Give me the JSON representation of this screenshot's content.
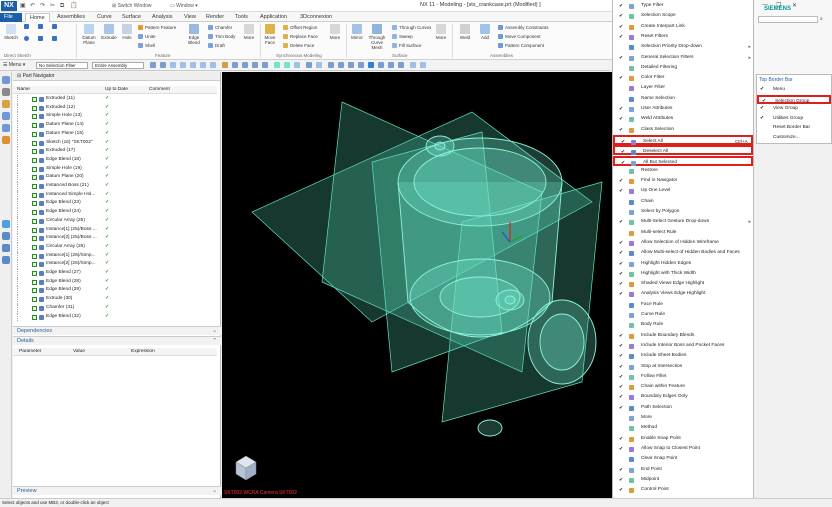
{
  "app": {
    "logo": "NX",
    "title": "NX 11 - Modeling - [sts_crankcase.prt (Modified) ]",
    "switch_window": "Switch Window",
    "window": "Window",
    "brand": "SIEMENS"
  },
  "tabs": [
    "File",
    "Home",
    "Assemblies",
    "Curve",
    "Surface",
    "Analysis",
    "View",
    "Render",
    "Tools",
    "Application",
    "3Dconnexion"
  ],
  "ribbon": {
    "sketch": "Sketch",
    "direct_sketch": "Direct Sketch",
    "datum": "Datum Plane",
    "extrude": "Extrude",
    "hole": "Hole",
    "pattern_feature": "Pattern Feature",
    "unite": "Unite",
    "shell": "Shell",
    "edge_blend": "Edge Blend",
    "chamfer": "Chamfer",
    "trim_body": "Trim Body",
    "draft": "Draft",
    "more1": "More",
    "feature": "Feature",
    "move_face": "Move Face",
    "offset_region": "Offset Region",
    "replace_face": "Replace Face",
    "delete_face": "Delete Face",
    "synchronous": "Synchronous Modeling",
    "more2": "More",
    "mirror": "Mirror",
    "through_curve_mesh": "Through Curve Mesh",
    "through_curves": "Through Curves",
    "sweep": "Sweep",
    "fill_surface": "Fill Surface",
    "surface": "Surface",
    "more3": "More",
    "weld": "Weld",
    "add": "Add",
    "assembly_constraints": "Assembly Constraints",
    "move_component": "Move Component",
    "pattern_component": "Pattern Component",
    "assemblies": "Assemblies"
  },
  "toolbar": {
    "menu": "Menu",
    "filter": "No Selection Filter",
    "scope": "Entire Assembly"
  },
  "navigator": {
    "title": "Part Navigator",
    "columns": [
      "Name",
      "Up to Date",
      "Comment"
    ],
    "rows": [
      "Extruded (11)",
      "Extruded (12)",
      "Simple Hole (13)",
      "Datum Plane (14)",
      "Datum Plane (15)",
      "Sketch (16) \"SKT002\"",
      "Extruded (17)",
      "Edge Blend (18)",
      "Simple Hole (19)",
      "Datum Plane (20)",
      "Instanced Boss (21)",
      "Instanced Simple Hol...",
      "Edge Blend (23)",
      "Edge Blend (24)",
      "Circular Array (25)",
      "Instance[1] (25)/Boss ...",
      "Instance[2] (25)/Boss ...",
      "Circular Array (26)",
      "Instance[1] (26)/Simp...",
      "Instance[2] (26)/Simp...",
      "Edge Blend (27)",
      "Edge Blend (28)",
      "Edge Blend (29)",
      "Extrude (30)",
      "Chamfer (31)",
      "Edge Blend (32)"
    ],
    "dependencies": "Dependencies",
    "details": "Details",
    "detail_cols": [
      "Parameter",
      "Value",
      "Expression"
    ],
    "preview": "Preview"
  },
  "viewport": {
    "caption": "SKT002 WCRA Camera SKT002"
  },
  "menu": {
    "items": [
      {
        "label": "Type Filter",
        "check": true
      },
      {
        "label": "Selection Scope",
        "check": true
      },
      {
        "label": "Create Interpart Link",
        "check": true
      },
      {
        "label": "Reset Filters",
        "check": true
      },
      {
        "label": "Selection Priority Drop-down",
        "check": false,
        "arrow": true
      },
      {
        "label": "General Selection Filters",
        "check": true,
        "arrow": true
      },
      {
        "label": "Detailed Filtering",
        "check": false
      },
      {
        "label": "Color Filter",
        "check": true
      },
      {
        "label": "Layer Filter",
        "check": false
      },
      {
        "label": "Name Selection",
        "check": false
      },
      {
        "label": "User Attributes",
        "check": true
      },
      {
        "label": "Weld Attributes",
        "check": true
      },
      {
        "label": "Class Selection",
        "check": true
      },
      {
        "label": "Select All",
        "check": true,
        "shortcut": "Ctrl+A",
        "hl": true
      },
      {
        "label": "Deselect All",
        "check": true,
        "hl": true
      },
      {
        "label": "All But Selected",
        "check": true,
        "hl": true
      },
      {
        "label": "Restore",
        "check": false
      },
      {
        "label": "Find in Navigator",
        "check": true
      },
      {
        "label": "Up One Level",
        "check": true
      },
      {
        "label": "Chain",
        "check": false
      },
      {
        "label": "Select by Polygon",
        "check": false
      },
      {
        "label": "Multi-Select Gesture Drop-down",
        "check": true,
        "arrow": true
      },
      {
        "label": "Multi-select Rule",
        "check": false
      },
      {
        "label": "Allow Selection of Hidden Wireframe",
        "check": true
      },
      {
        "label": "Allow Multi-select of Hidden Bodies and Faces",
        "check": true
      },
      {
        "label": "Highlight Hidden Edges",
        "check": true
      },
      {
        "label": "Highlight with Thick Width",
        "check": true
      },
      {
        "label": "Shaded Views Edge Highlight",
        "check": true
      },
      {
        "label": "Analysis Views Edge Highlight",
        "check": true
      },
      {
        "label": "Face Rule",
        "check": false
      },
      {
        "label": "Curve Rule",
        "check": false
      },
      {
        "label": "Body Rule",
        "check": false
      },
      {
        "label": "Include Boundary Blends",
        "check": true
      },
      {
        "label": "Include Interior Boss and Pocket Faces",
        "check": true
      },
      {
        "label": "Include Sheet Bodies",
        "check": true
      },
      {
        "label": "Stop at Intersection",
        "check": true
      },
      {
        "label": "Follow Fillet",
        "check": true
      },
      {
        "label": "Chain within Feature",
        "check": true
      },
      {
        "label": "Boundary Edges Only",
        "check": true
      },
      {
        "label": "Path Selection",
        "check": true
      },
      {
        "label": "More",
        "check": false
      },
      {
        "label": "Method",
        "check": false
      },
      {
        "label": "Enable Snap Point",
        "check": true
      },
      {
        "label": "Allow Snap to Closest Point",
        "check": true
      },
      {
        "label": "Clear Snap Point",
        "check": false
      },
      {
        "label": "End Point",
        "check": true
      },
      {
        "label": "Midpoint",
        "check": true
      },
      {
        "label": "Control Point",
        "check": true
      }
    ]
  },
  "submenu": {
    "title": "Top Border Bar",
    "items": [
      {
        "label": "Menu",
        "check": true
      },
      {
        "label": "Selection Group",
        "check": true,
        "hl": true
      },
      {
        "label": "View Group",
        "check": true
      },
      {
        "label": "Utilities Group",
        "check": true
      },
      {
        "label": "Reset Border Bar",
        "check": false
      },
      {
        "label": "Customize...",
        "check": false
      }
    ]
  },
  "status": "Select objects and use MB3, or double-click an object",
  "colors": {
    "accent": "#1a5fa8",
    "highlight": "#e01e1e",
    "model": "#6fe6c9"
  }
}
